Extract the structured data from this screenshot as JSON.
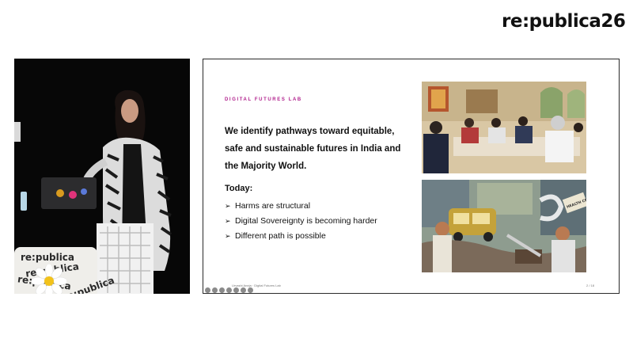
{
  "brand": {
    "logo_text": "re:publica26"
  },
  "video": {
    "podium_texts": [
      "re:publica",
      "re:publica",
      "re:publica",
      "re:publica"
    ]
  },
  "slide": {
    "eyebrow": "DIGITAL FUTURES LAB",
    "headline_lines": [
      "We identify pathways toward equitable,",
      "safe and sustainable futures in India and",
      "the Majority World."
    ],
    "today_label": "Today:",
    "bullets": [
      {
        "marker": "➢",
        "text": "Harms are structural"
      },
      {
        "marker": "➢",
        "text": "Digital Sovereignty is becoming harder"
      },
      {
        "marker": "➢",
        "text": "Different path is possible"
      }
    ],
    "footer_text": "Urvashi Aneja · Digital Futures Lab",
    "page_number": "2 / 18",
    "illustration_sign": "HEALTH CENTRE"
  },
  "colors": {
    "accent": "#b01f8c",
    "frame": "#2a2a2a"
  },
  "icons": [
    "prev-slide-icon",
    "pen-icon",
    "zoom-icon",
    "grid-icon",
    "camera-icon",
    "more-icon",
    "next-slide-icon"
  ]
}
